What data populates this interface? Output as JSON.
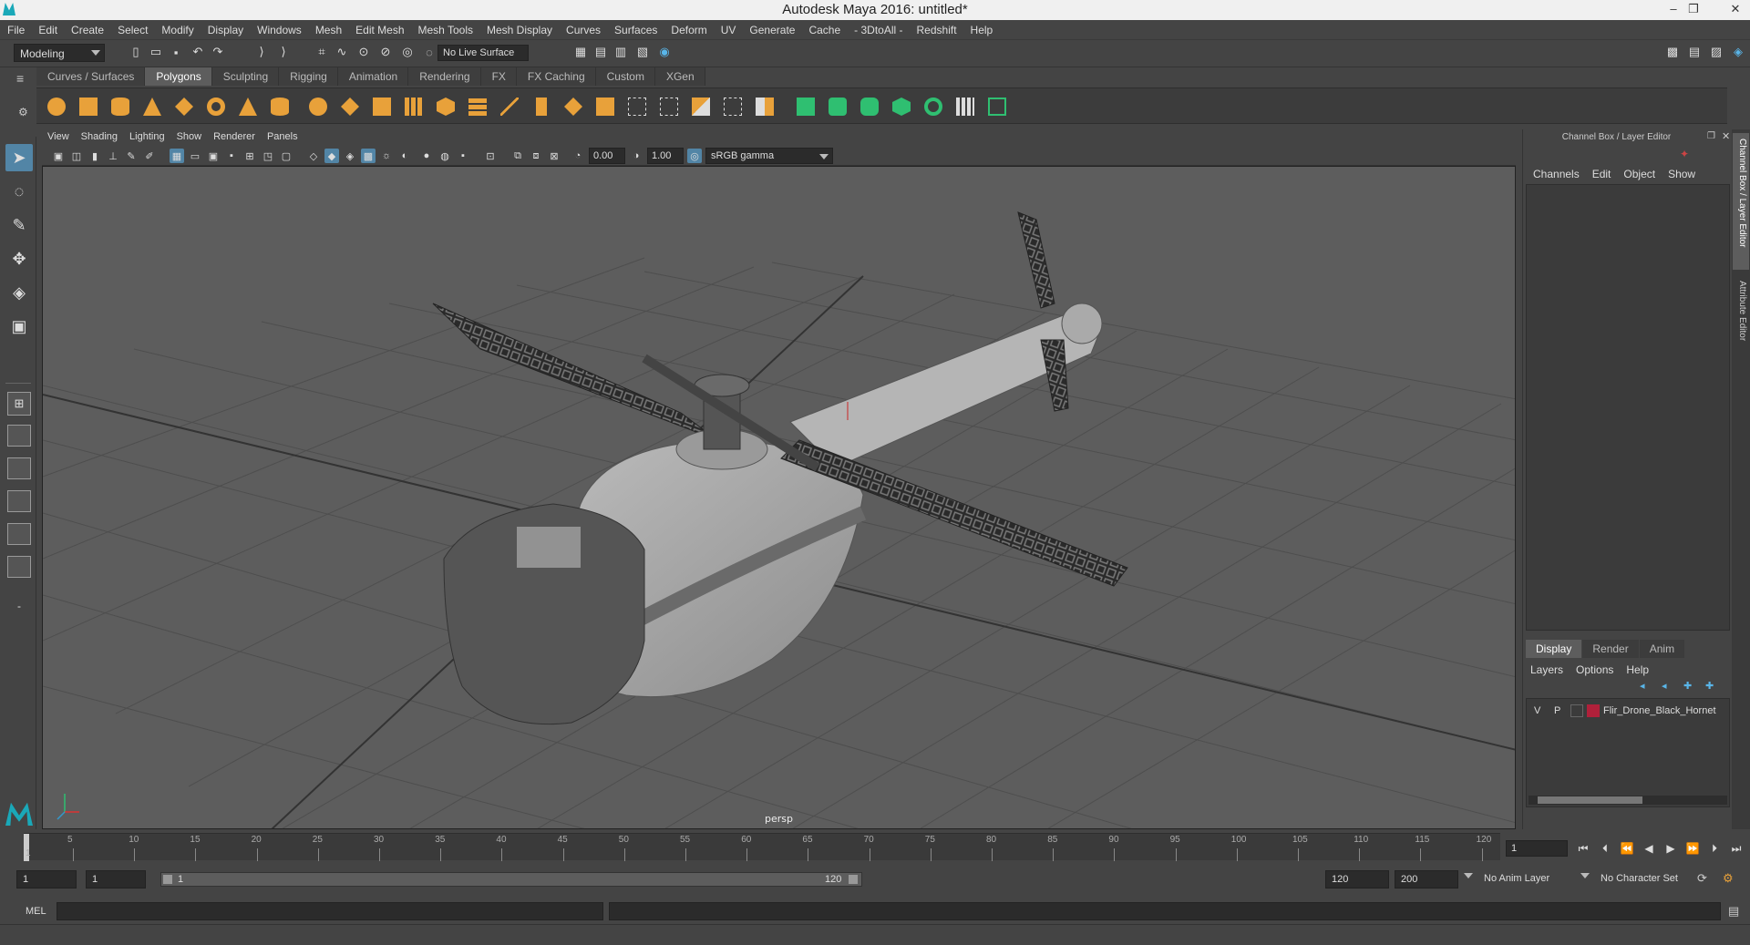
{
  "window": {
    "title": "Autodesk Maya 2016: untitled*",
    "minimize": "–",
    "restore": "❐",
    "close": "✕"
  },
  "menubar": [
    "File",
    "Edit",
    "Create",
    "Select",
    "Modify",
    "Display",
    "Windows",
    "Mesh",
    "Edit Mesh",
    "Mesh Tools",
    "Mesh Display",
    "Curves",
    "Surfaces",
    "Deform",
    "UV",
    "Generate",
    "Cache",
    "- 3DtoAll -",
    "Redshift",
    "Help"
  ],
  "statusline": {
    "mode": "Modeling",
    "live_surface": "No Live Surface"
  },
  "shelf": {
    "tabs": [
      "Curves / Surfaces",
      "Polygons",
      "Sculpting",
      "Rigging",
      "Animation",
      "Rendering",
      "FX",
      "FX Caching",
      "Custom",
      "XGen"
    ],
    "active_tab": "Polygons",
    "accent_color": "#e8a13a"
  },
  "viewport": {
    "menu": [
      "View",
      "Shading",
      "Lighting",
      "Show",
      "Renderer",
      "Panels"
    ],
    "exposure": "0.00",
    "gamma": "1.00",
    "color_space": "sRGB gamma",
    "camera_label": "persp"
  },
  "channelbox": {
    "title": "Channel Box / Layer Editor",
    "menu": [
      "Channels",
      "Edit",
      "Object",
      "Show"
    ],
    "layer_tabs": [
      "Display",
      "Render",
      "Anim"
    ],
    "layer_menu": [
      "Layers",
      "Options",
      "Help"
    ],
    "layer": {
      "v": "V",
      "p": "P",
      "name": "Flir_Drone_Black_Hornet",
      "color": "#b0203a"
    }
  },
  "side_tabs": [
    "Channel Box / Layer Editor",
    "Attribute Editor"
  ],
  "timeline": {
    "labels": [
      "5",
      "10",
      "15",
      "20",
      "25",
      "30",
      "35",
      "40",
      "45",
      "50",
      "55",
      "60",
      "65",
      "70",
      "75",
      "80",
      "85",
      "90",
      "95",
      "100",
      "105",
      "110",
      "115",
      "120"
    ],
    "first_label": "1",
    "current_frame": "1",
    "range_start": "1",
    "anim_start": "1",
    "range_start_inner": "1",
    "range_end_inner": "120",
    "range_end": "120",
    "anim_end": "200",
    "anim_layer": "No Anim Layer",
    "character_set": "No Character Set"
  },
  "commandline": {
    "label": "MEL"
  }
}
